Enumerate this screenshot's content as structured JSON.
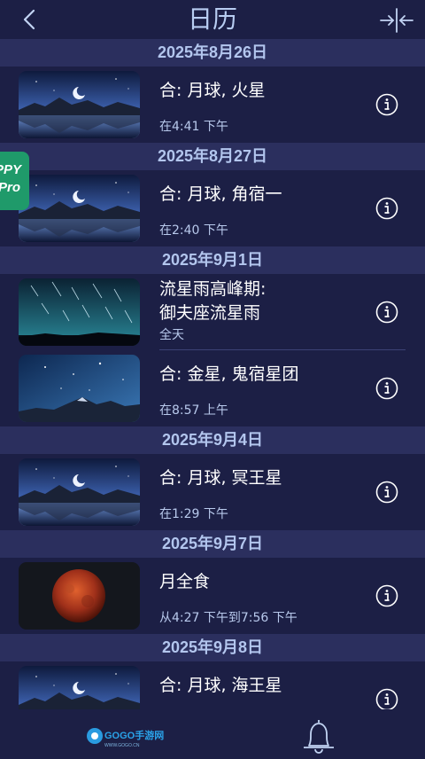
{
  "header": {
    "title": "日历"
  },
  "badge": {
    "line1": "PPY",
    "line2": "Pro"
  },
  "sections": [
    {
      "date": "2025年8月26日",
      "events": [
        {
          "title": "合: 月球, 火星",
          "time": "在4:41 下午",
          "image": "moon-lake"
        }
      ]
    },
    {
      "date": "2025年8月27日",
      "events": [
        {
          "title": "合: 月球, 角宿一",
          "time": "在2:40 下午",
          "image": "moon-lake"
        }
      ]
    },
    {
      "date": "2025年9月1日",
      "events": [
        {
          "title1": "流星雨高峰期:",
          "title2": "御夫座流星雨",
          "time": "全天",
          "image": "meteor-shower"
        },
        {
          "title": "合: 金星, 鬼宿星团",
          "time": "在8:57 上午",
          "image": "starry-mountains"
        }
      ]
    },
    {
      "date": "2025年9月4日",
      "events": [
        {
          "title": "合: 月球, 冥王星",
          "time": "在1:29 下午",
          "image": "moon-lake"
        }
      ]
    },
    {
      "date": "2025年9月7日",
      "events": [
        {
          "title": "月全食",
          "time": "从4:27 下午到7:56 下午",
          "image": "blood-moon"
        }
      ]
    },
    {
      "date": "2025年9月8日",
      "events": [
        {
          "title": "合: 月球, 海王星",
          "time": "",
          "image": "moon-lake"
        }
      ]
    }
  ],
  "watermark": {
    "text": "GOGO手游网",
    "url_text": "WWW.GOGO.CN"
  },
  "icons": {
    "back": "chevron-left-icon",
    "compress": "compress-arrows-icon",
    "info": "info-circle-icon",
    "bell": "bell-icon"
  },
  "colors": {
    "background": "#1c1f45",
    "date_header_bg": "#2b2f5e",
    "date_header_text": "#b3c6ee",
    "title_color": "#b8cdf2"
  }
}
